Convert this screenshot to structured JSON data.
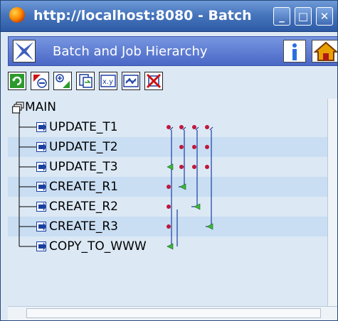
{
  "browser": {
    "title": "http://localhost:8080 - Batch",
    "controls": [
      "_",
      "□",
      "✕"
    ]
  },
  "app": {
    "title": "Batch and Job Hierarchy",
    "info_label": "i"
  },
  "toolbar": {
    "tools": [
      "refresh-icon",
      "collapse-icon",
      "expand-icon",
      "copy-icon",
      "xy-icon",
      "link-icon",
      "delete-icon"
    ]
  },
  "tree": {
    "root": "MAIN",
    "jobs": [
      "UPDATE_T1",
      "UPDATE_T2",
      "UPDATE_T3",
      "CREATE_R1",
      "CREATE_R2",
      "CREATE_R3",
      "COPY_TO_WWW"
    ]
  },
  "colors": {
    "accent": "#4a67c6",
    "dependency_dot": "#c0183a",
    "dependency_arrow": "#3cb43c",
    "connector": "#1a3fa0"
  }
}
